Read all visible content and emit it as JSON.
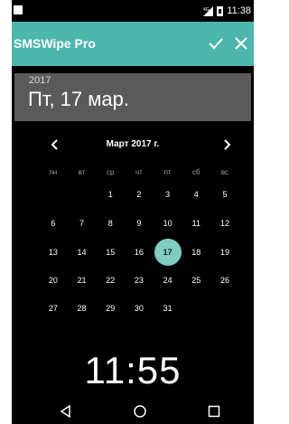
{
  "status_bar": {
    "time": "11:38"
  },
  "app_bar": {
    "title": "SMSWipe Pro"
  },
  "date_header": {
    "year": "2017",
    "date": "Пт, 17 мар."
  },
  "calendar": {
    "month_title": "Март 2017 г.",
    "weekdays": [
      "пн",
      "вт",
      "ср",
      "чт",
      "пт",
      "сб",
      "вс"
    ],
    "weeks": [
      [
        "",
        "",
        "1",
        "2",
        "3",
        "4",
        "5"
      ],
      [
        "6",
        "7",
        "8",
        "9",
        "10",
        "11",
        "12"
      ],
      [
        "13",
        "14",
        "15",
        "16",
        "17",
        "18",
        "19"
      ],
      [
        "20",
        "21",
        "22",
        "23",
        "24",
        "25",
        "26"
      ],
      [
        "27",
        "28",
        "29",
        "30",
        "31",
        "",
        ""
      ]
    ],
    "selected_day": "17"
  },
  "clock": {
    "time": "11:55"
  },
  "colors": {
    "accent": "#4db6ac",
    "selected_day": "#80cbc4",
    "header_bg": "#5a5a5a"
  }
}
